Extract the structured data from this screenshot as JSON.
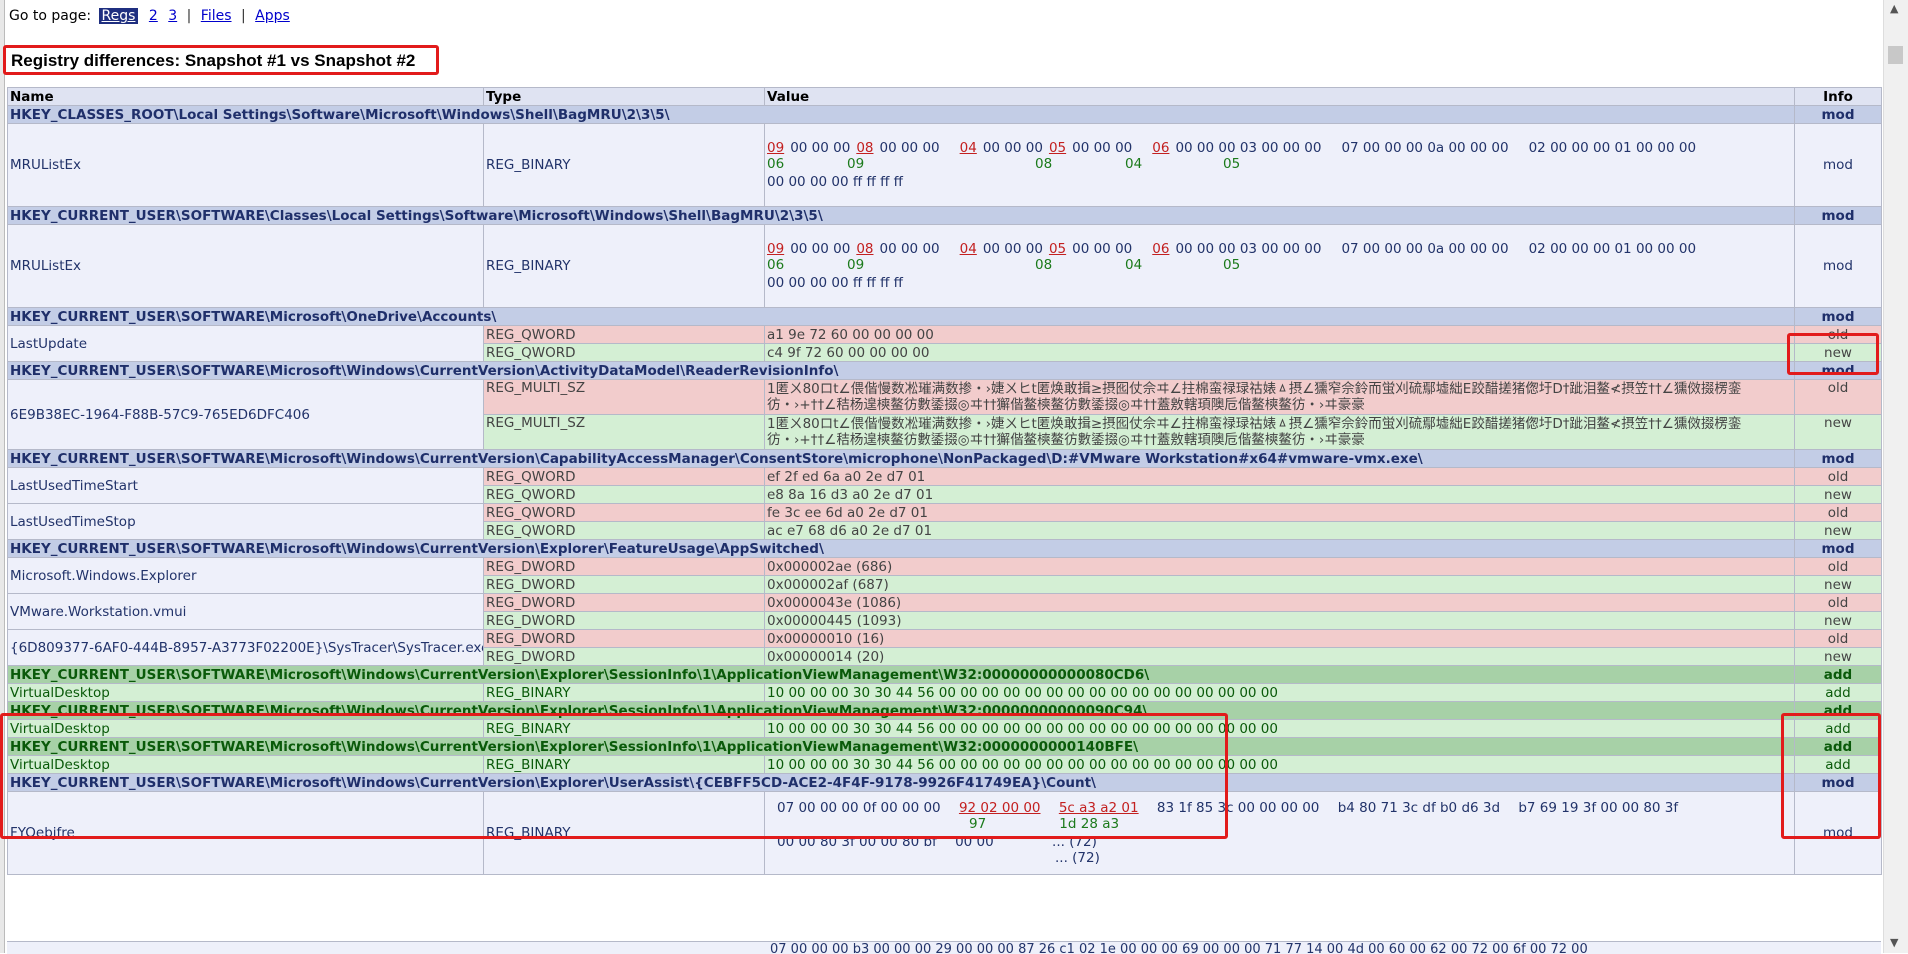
{
  "nav": {
    "label": "Go to page:",
    "links": [
      "Regs",
      "2",
      "3",
      "Files",
      "Apps"
    ],
    "sep": "|"
  },
  "title": "Registry differences: Snapshot #1 vs Snapshot #2",
  "headers": {
    "name": "Name",
    "type": "Type",
    "value": "Value",
    "info": "Info"
  },
  "keys": {
    "k1": "HKEY_CLASSES_ROOT\\Local Settings\\Software\\Microsoft\\Windows\\Shell\\BagMRU\\2\\3\\5\\",
    "k2": "HKEY_CURRENT_USER\\SOFTWARE\\Classes\\Local Settings\\Software\\Microsoft\\Windows\\Shell\\BagMRU\\2\\3\\5\\",
    "k3": "HKEY_CURRENT_USER\\SOFTWARE\\Microsoft\\OneDrive\\Accounts\\",
    "k4": "HKEY_CURRENT_USER\\SOFTWARE\\Microsoft\\Windows\\CurrentVersion\\ActivityDataModel\\ReaderRevisionInfo\\",
    "k5": "HKEY_CURRENT_USER\\SOFTWARE\\Microsoft\\Windows\\CurrentVersion\\CapabilityAccessManager\\ConsentStore\\microphone\\NonPackaged\\D:#VMware Workstation#x64#vmware-vmx.exe\\",
    "k6": "HKEY_CURRENT_USER\\SOFTWARE\\Microsoft\\Windows\\CurrentVersion\\Explorer\\FeatureUsage\\AppSwitched\\",
    "k7": "HKEY_CURRENT_USER\\SOFTWARE\\Microsoft\\Windows\\CurrentVersion\\Explorer\\SessionInfo\\1\\ApplicationViewManagement\\W32:00000000000080CD6\\",
    "k8": "HKEY_CURRENT_USER\\SOFTWARE\\Microsoft\\Windows\\CurrentVersion\\Explorer\\SessionInfo\\1\\ApplicationViewManagement\\W32:00000000000090C94\\",
    "k9": "HKEY_CURRENT_USER\\SOFTWARE\\Microsoft\\Windows\\CurrentVersion\\Explorer\\SessionInfo\\1\\ApplicationViewManagement\\W32:0000000000140BFE\\",
    "k10": "HKEY_CURRENT_USER\\SOFTWARE\\Microsoft\\Windows\\CurrentVersion\\Explorer\\UserAssist\\{CEBFF5CD-ACE2-4F4F-9178-9926F41749EA}\\Count\\"
  },
  "info": {
    "mod": "mod",
    "old": "old",
    "new": "new",
    "add": "add"
  },
  "types": {
    "bin": "REG_BINARY",
    "qword": "REG_QWORD",
    "multi": "REG_MULTI_SZ",
    "dword": "REG_DWORD"
  },
  "names": {
    "mru": "MRUListEx",
    "lastupdate": "LastUpdate",
    "guid": "6E9B38EC-1964-F88B-57C9-765ED6DFC406",
    "lutstart": "LastUsedTimeStart",
    "lutstop": "LastUsedTimeStop",
    "explorer": "Microsoft.Windows.Explorer",
    "vmui": "VMware.Workstation.vmui",
    "systracer": "{6D809377-6AF0-444B-8957-A3773F02200E}\\SysTracer\\SysTracer.exe",
    "vdesk": "VirtualDesktop",
    "fyo": "FYOebjfre"
  },
  "values": {
    "lu_old": "a1 9e 72 60 00 00 00 00",
    "lu_new": "c4 9f 72 60 00 00 00 00",
    "multi_old": "1匿ㄨ80ロt∠偎偕慢数凇璀满数掺・›婕ㄨヒt匿焕敢揖≥摂囮仗佘ヰ∠拄棉蛮禄琭祜婊ㅿ摂∠獯窄佘鈴而蛍刈硫鄢墟絀E跤醋搓猪偬圩D†跐泪鳌≮摂笠††∠獯傚掇楞銮彷・›+††∠秸杨遑樉鳌彷數鋈掇◎ヰ††獬偕鳌樉鳌彷數鋈掇◎ヰ††蓋敫轄頊隩卮偕鳌樉鳌彷・›ヰ豪豪",
    "multi_new": "1匿ㄨ80ロt∠偎偕慢数凇璀满数掺・›婕ㄨヒt匿焕敢揖≥摂囮仗佘ヰ∠拄棉蛮禄琭祜婊ㅿ摂∠獯窄佘鈴而蛍刈硫鄢墟絀E跤醋搓猪偬圩D†跐泪鳌≮摂笠††∠獯傚掇楞銮彷・›+††∠秸杨遑樉鳌彷數鋈掇◎ヰ††獬偕鳌樉鳌彷數鋈掇◎ヰ††蓋敫轄頊隩卮偕鳌樉鳌彷・›ヰ豪豪",
    "lts_old": "ef 2f ed 6a a0 2e d7 01",
    "lts_new": "e8 8a 16 d3 a0 2e d7 01",
    "ltp_old": "fe 3c ee 6d a0 2e d7 01",
    "ltp_new": "ac e7 68 d6 a0 2e d7 01",
    "exp_old": "0x000002ae (686)",
    "exp_new": "0x000002af (687)",
    "vm_old": "0x0000043e (1086)",
    "vm_new": "0x00000445 (1093)",
    "sys_old": "0x00000010 (16)",
    "sys_new": "0x00000014 (20)",
    "vdesk": "10 00 00 00 30 30 44 56 00 00 00 00 00 00 00 00 00 00 00 00 00 00 00 00",
    "mru_line3": "00 00 00 00 ff ff ff ff",
    "fyo_line1a": "07 00 00 00 0f 00 00 00",
    "fyo_line1b": "92 02 00 00",
    "fyo_line1c": "5c a3 a2 01",
    "fyo_line1d": "83 1f 85 3c 00 00 00 00",
    "fyo_line1e": "b4 80 71 3c df b0 d6 3d",
    "fyo_line1f": "b7 69 19 3f 00 00 80 3f",
    "fyo_sub1": "97",
    "fyo_sub2": "1d 28 a3",
    "fyo_line3a": "00 00 80 3f 00 00 80 bf",
    "fyo_line3b": "00 00",
    "fyo_more1": "... (72)",
    "fyo_more2": "... (72)",
    "bottom_row": "07 00 00 00 b3 00 00 00   29 00 00 00   87 26 c1 02   1e 00 00 00 69 00 00 00   71 77 14 00 4d 00 60 00   62 00 72 00 6f 00 72 00"
  }
}
